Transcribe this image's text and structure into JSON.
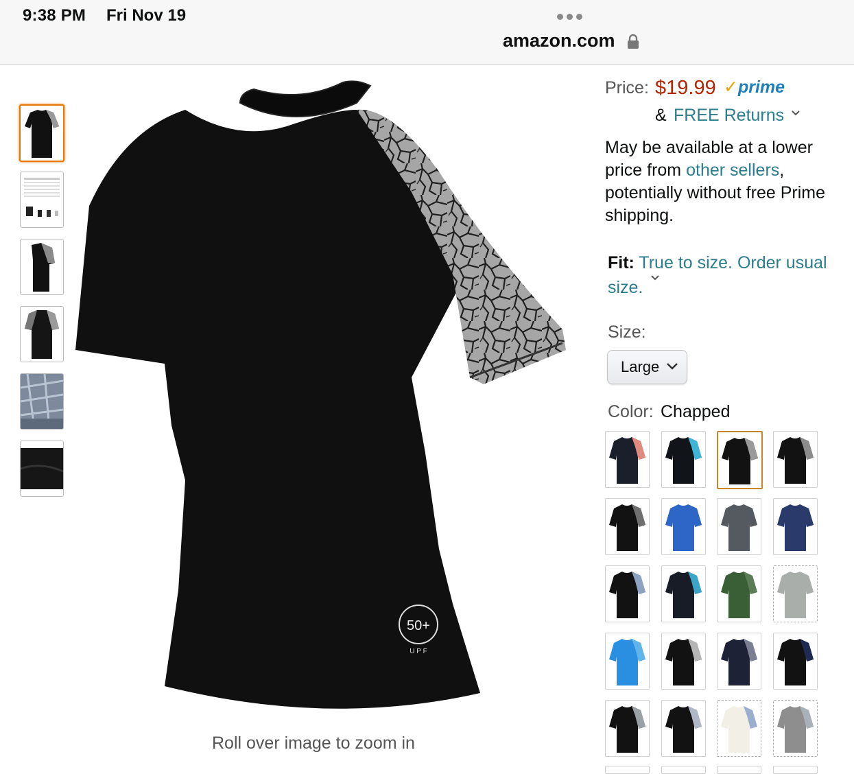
{
  "status_bar": {
    "time": "9:38 PM",
    "date": "Fri Nov 19",
    "url": "amazon.com",
    "icons": [
      "more-dots-icon",
      "lock-icon"
    ]
  },
  "gallery": {
    "thumbnails": [
      "thumb-shirt-front",
      "thumb-size-chart",
      "thumb-shirt-side",
      "thumb-shirt-back",
      "thumb-fabric-texture",
      "thumb-fabric-black"
    ],
    "selected_index": 0,
    "zoom_hint": "Roll over image to zoom in",
    "badge_text": "50+ UPF"
  },
  "buybox": {
    "price_label": "Price:",
    "price": "$19.99",
    "prime_label": "prime",
    "returns_prefix": "&",
    "returns_text": "FREE Returns",
    "availability_text_1": "May be available at a lower price from ",
    "availability_link": "other sellers",
    "availability_text_2": ", potentially without free Prime shipping.",
    "fit_label": "Fit:",
    "fit_value": "True to size. Order usual size.",
    "size_label": "Size:",
    "size_value": "Large",
    "color_label": "Color:",
    "color_value": "Chapped"
  },
  "colors": {
    "swatches": [
      {
        "body": "#1a1f2b",
        "sleeve": "#e08a80"
      },
      {
        "body": "#111418",
        "sleeve": "#3fb4d6"
      },
      {
        "body": "#121212",
        "sleeve": "#9a9a9a"
      },
      {
        "body": "#121212",
        "sleeve": "#8c8c8c"
      },
      {
        "body": "#121212",
        "sleeve": "#6f6f6f"
      },
      {
        "body": "#2d66c7",
        "sleeve": "#2d66c7"
      },
      {
        "body": "#555a60",
        "sleeve": "#555a60"
      },
      {
        "body": "#2a3a6a",
        "sleeve": "#2a3a6a"
      },
      {
        "body": "#121212",
        "sleeve": "#8ea2c2"
      },
      {
        "body": "#181c26",
        "sleeve": "#3aa5c9"
      },
      {
        "body": "#3a5e36",
        "sleeve": "#5a7d55"
      },
      {
        "body": "#a9aeab",
        "sleeve": "#a9aeab"
      },
      {
        "body": "#2a8fe0",
        "sleeve": "#5fb4ea"
      },
      {
        "body": "#121212",
        "sleeve": "#b5b5b5"
      },
      {
        "body": "#1e2236",
        "sleeve": "#7a7f92"
      },
      {
        "body": "#121212",
        "sleeve": "#1e2a52"
      },
      {
        "body": "#121212",
        "sleeve": "#9aa0a6"
      },
      {
        "body": "#121212",
        "sleeve": "#b0b8c8"
      },
      {
        "body": "#f1efe6",
        "sleeve": "#9aaed0"
      },
      {
        "body": "#8e8e8e",
        "sleeve": "#a8b0b8"
      }
    ],
    "selected_index": 2,
    "dashed_indices": [
      11,
      18,
      19
    ]
  }
}
